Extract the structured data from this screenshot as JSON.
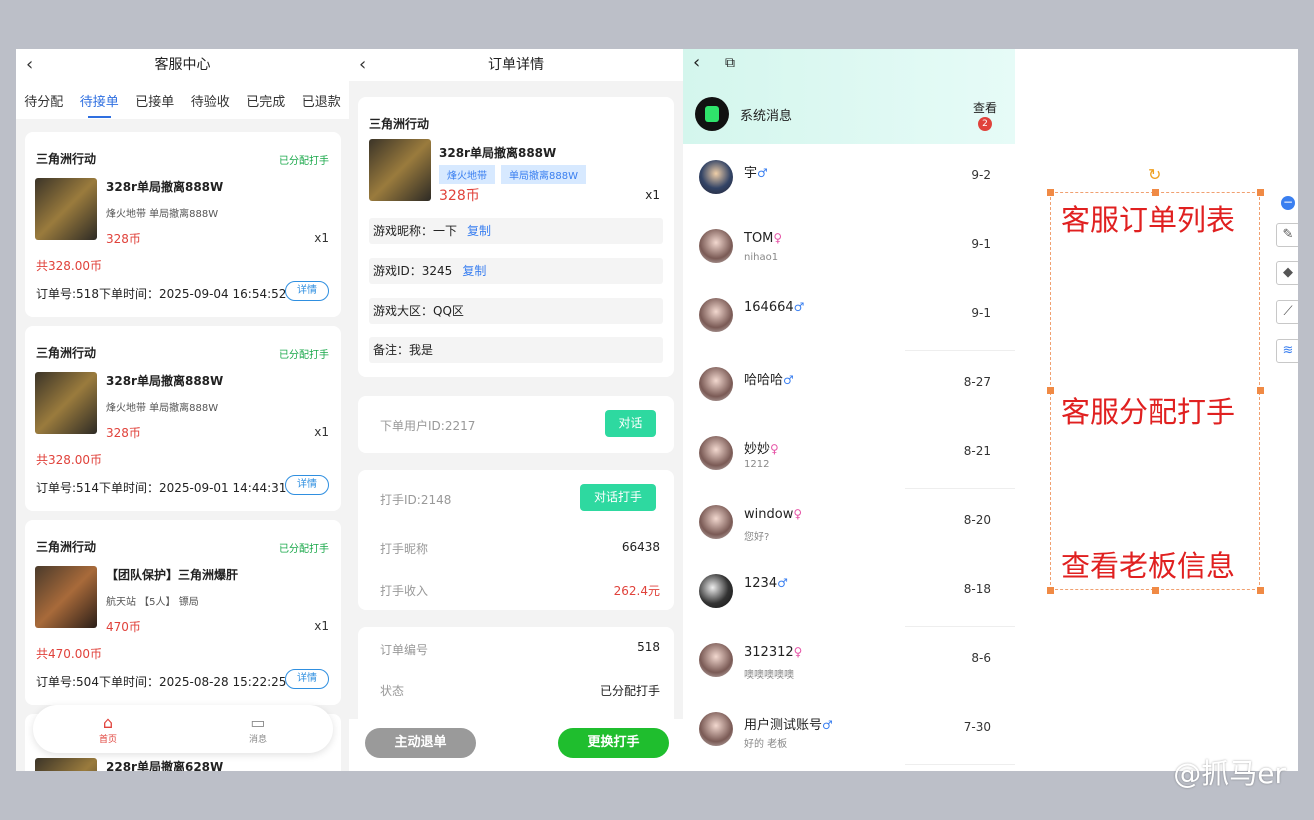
{
  "panel1": {
    "title": "客服中心",
    "tabs": [
      "待分配",
      "待接单",
      "已接单",
      "待验收",
      "已完成",
      "已退款"
    ],
    "active_tab": "待接单",
    "orders": [
      {
        "game": "三角洲行动",
        "status": "已分配打手",
        "title": "328r单局撤离888W",
        "sub": "烽火地带 单局撤离888W",
        "price": "328币",
        "qty": "x1",
        "total": "共328.00币",
        "order_line": "订单号:518下单时间：2025-09-04 16:54:52",
        "detail": "详情"
      },
      {
        "game": "三角洲行动",
        "status": "已分配打手",
        "title": "328r单局撤离888W",
        "sub": "烽火地带 单局撤离888W",
        "price": "328币",
        "qty": "x1",
        "total": "共328.00币",
        "order_line": "订单号:514下单时间：2025-09-01 14:44:31",
        "detail": "详情"
      },
      {
        "game": "三角洲行动",
        "status": "已分配打手",
        "title": "【团队保护】三角洲爆肝",
        "sub": "航天站 【5人】 镖局",
        "price": "470币",
        "qty": "x1",
        "total": "共470.00币",
        "order_line": "订单号:504下单时间：2025-08-28 15:22:25",
        "detail": "详情"
      },
      {
        "game": "",
        "status": "",
        "title": "228r单局撤离628W",
        "sub": "",
        "price": "",
        "qty": "",
        "total": "",
        "order_line": "",
        "detail": ""
      }
    ],
    "nav": [
      {
        "label": "首页",
        "icon": "home-icon"
      },
      {
        "label": "消息",
        "icon": "message-icon"
      }
    ]
  },
  "panel2": {
    "title": "订单详情",
    "game": "三角洲行动",
    "item_title": "328r单局撤离888W",
    "tags": [
      "烽火地带",
      "单局撤离888W"
    ],
    "price": "328币",
    "qty": "x1",
    "fields": [
      {
        "label": "游戏昵称：一下",
        "copy": "复制"
      },
      {
        "label": "游戏ID：3245",
        "copy": "复制"
      },
      {
        "label": "游戏大区：QQ区",
        "copy": ""
      },
      {
        "label": "备注：我是",
        "copy": ""
      }
    ],
    "buyer_id": "下单用户ID:2217",
    "chat_btn": "对话",
    "player_id": "打手ID:2148",
    "chat_player_btn": "对话打手",
    "player_name_label": "打手昵称",
    "player_name": "66438",
    "income_label": "打手收入",
    "income": "262.4元",
    "order_no_label": "订单编号",
    "order_no": "518",
    "state_label": "状态",
    "state": "已分配打手",
    "refund_btn": "主动退单",
    "change_btn": "更换打手"
  },
  "panel3": {
    "system_name": "系统消息",
    "look_label": "查看",
    "badge": "2",
    "messages": [
      {
        "name": "宇",
        "gender": "♂",
        "sub": "",
        "date": "9-2",
        "avatar": "b0"
      },
      {
        "name": "TOM",
        "gender": "♀",
        "sub": "nihao1",
        "date": "9-1",
        "avatar": ""
      },
      {
        "name": "164664",
        "gender": "♂",
        "sub": "",
        "date": "9-1",
        "avatar": ""
      },
      {
        "name": "哈哈哈",
        "gender": "♂",
        "sub": "",
        "date": "8-27",
        "avatar": ""
      },
      {
        "name": "妙妙",
        "gender": "♀",
        "sub": "1212",
        "date": "8-21",
        "avatar": ""
      },
      {
        "name": "window",
        "gender": "♀",
        "sub": "您好?",
        "date": "8-20",
        "avatar": ""
      },
      {
        "name": "1234",
        "gender": "♂",
        "sub": "",
        "date": "8-18",
        "avatar": "bw"
      },
      {
        "name": "312312",
        "gender": "♀",
        "sub": "噢噢噢噢噢",
        "date": "8-6",
        "avatar": ""
      },
      {
        "name": "用户测试账号",
        "gender": "♂",
        "sub": "好的 老板",
        "date": "7-30",
        "avatar": ""
      }
    ]
  },
  "annotations": [
    "客服订单列表",
    "客服分配打手",
    "查看老板信息"
  ],
  "watermark": "@抓马er",
  "colors": {
    "accent_blue": "#2f6fe0",
    "price_red": "#e0423b",
    "green": "#1fbe2e",
    "teal": "#2ed9a0",
    "annotation_red": "#e02020"
  }
}
